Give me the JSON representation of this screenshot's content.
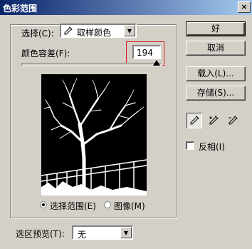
{
  "window": {
    "title": "色彩范围",
    "close_glyph": "×"
  },
  "select": {
    "label": "选择(C):",
    "value": "取样颜色"
  },
  "tolerance": {
    "label": "颜色容差(F):",
    "value": "194",
    "max": 200
  },
  "preview_options": [
    {
      "label": "选择范围(E)",
      "checked": true
    },
    {
      "label": "图像(M)",
      "checked": false
    }
  ],
  "selection_preview": {
    "label": "选区预览(T):",
    "value": "无"
  },
  "buttons": {
    "ok": "好",
    "cancel": "取消",
    "load": "载入(L)...",
    "save": "存储(S)..."
  },
  "invert": {
    "label": "反相(I)",
    "checked": false
  },
  "droppers": [
    "eyedropper-icon",
    "eyedropper-plus-icon",
    "eyedropper-minus-icon"
  ]
}
